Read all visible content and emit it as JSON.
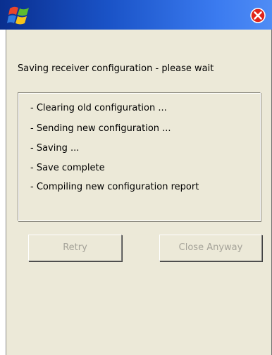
{
  "titlebar": {
    "logo_icon": "windows-flag-icon",
    "close_icon": "close-icon",
    "close_color": "#e0241a"
  },
  "dialog": {
    "heading": "Saving receiver configuration - please wait",
    "steps": [
      "- Clearing old configuration ...",
      "- Sending new configuration ...",
      "- Saving ...",
      "- Save complete",
      "- Compiling new configuration report"
    ]
  },
  "buttons": {
    "retry_label": "Retry",
    "close_anyway_label": "Close Anyway"
  }
}
